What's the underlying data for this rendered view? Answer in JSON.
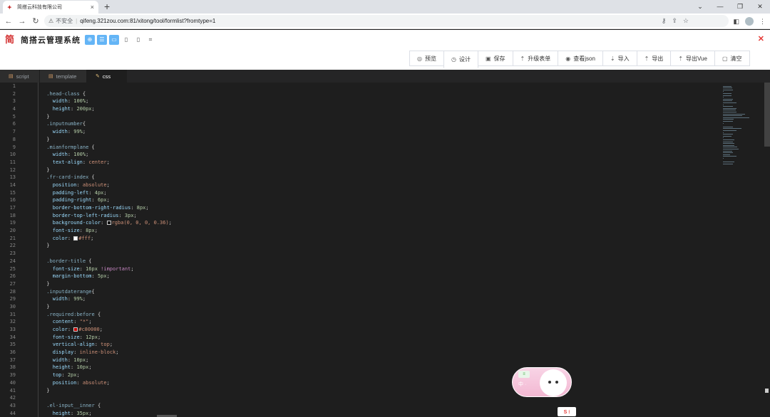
{
  "browser": {
    "tab_title": "简搭云科技有限公司",
    "tab_close": "×",
    "new_tab": "+",
    "url_warning": "⚠",
    "insecure_label": "不安全",
    "url_sep": "|",
    "url": "qifeng.321zou.com:81/xitong/tool/formlist?fromtype=1",
    "win_controls": [
      "⌄",
      "—",
      "❐",
      "✕"
    ]
  },
  "app": {
    "logo_text": "简",
    "title": "简搭云管理系统",
    "header_icons": [
      {
        "name": "globe-icon",
        "glyph": "⊕",
        "active": true
      },
      {
        "name": "menu-icon",
        "glyph": "☰",
        "active": true
      },
      {
        "name": "monitor-icon",
        "glyph": "▭",
        "active": true
      },
      {
        "name": "tablet-icon",
        "glyph": "▯",
        "active": false
      },
      {
        "name": "phone-icon",
        "glyph": "▯",
        "active": false
      },
      {
        "name": "grid-icon",
        "glyph": "⌗",
        "active": false
      }
    ],
    "close_label": "✕"
  },
  "actions": [
    {
      "icon": "◎",
      "label": "预览"
    },
    {
      "icon": "◷",
      "label": "设计",
      "active": true
    },
    {
      "icon": "▣",
      "label": "保存"
    },
    {
      "icon": "⇡",
      "label": "升级表单"
    },
    {
      "icon": "◉",
      "label": "查看json"
    },
    {
      "icon": "⇣",
      "label": "导入"
    },
    {
      "icon": "⇡",
      "label": "导出"
    },
    {
      "icon": "⇡",
      "label": "导出Vue"
    },
    {
      "icon": "▢",
      "label": "清空"
    }
  ],
  "editor_tabs": [
    {
      "icon": "▤",
      "label": "script"
    },
    {
      "icon": "▤",
      "label": "template"
    },
    {
      "icon": "✎",
      "label": "css",
      "active": true
    }
  ],
  "code_lines": [
    [],
    [
      [
        "sel",
        ".head-class"
      ],
      [
        "punc",
        " {"
      ]
    ],
    [
      [
        "prop",
        "  width"
      ],
      [
        "punc",
        ": "
      ],
      [
        "num",
        "100%"
      ],
      [
        "punc",
        ";"
      ]
    ],
    [
      [
        "prop",
        "  height"
      ],
      [
        "punc",
        ": "
      ],
      [
        "num",
        "200px"
      ],
      [
        "punc",
        ";"
      ]
    ],
    [
      [
        "punc",
        "}"
      ]
    ],
    [
      [
        "sel",
        ".inputnumber"
      ],
      [
        "punc",
        "{"
      ]
    ],
    [
      [
        "prop",
        "  width"
      ],
      [
        "punc",
        ": "
      ],
      [
        "num",
        "99%"
      ],
      [
        "punc",
        ";"
      ]
    ],
    [
      [
        "punc",
        "}"
      ]
    ],
    [
      [
        "sel",
        ".mianformplane"
      ],
      [
        "punc",
        " {"
      ]
    ],
    [
      [
        "prop",
        "  width"
      ],
      [
        "punc",
        ": "
      ],
      [
        "num",
        "100%"
      ],
      [
        "punc",
        ";"
      ]
    ],
    [
      [
        "prop",
        "  text-align"
      ],
      [
        "punc",
        ": "
      ],
      [
        "val",
        "center"
      ],
      [
        "punc",
        ";"
      ]
    ],
    [
      [
        "punc",
        "}"
      ]
    ],
    [
      [
        "sel",
        ".fr-card-index"
      ],
      [
        "punc",
        " {"
      ]
    ],
    [
      [
        "prop",
        "  position"
      ],
      [
        "punc",
        ": "
      ],
      [
        "val",
        "absolute"
      ],
      [
        "punc",
        ";"
      ]
    ],
    [
      [
        "prop",
        "  padding-left"
      ],
      [
        "punc",
        ": "
      ],
      [
        "num",
        "4px"
      ],
      [
        "punc",
        ";"
      ]
    ],
    [
      [
        "prop",
        "  padding-right"
      ],
      [
        "punc",
        ": "
      ],
      [
        "num",
        "6px"
      ],
      [
        "punc",
        ";"
      ]
    ],
    [
      [
        "prop",
        "  border-bottom-right-radius"
      ],
      [
        "punc",
        ": "
      ],
      [
        "num",
        "8px"
      ],
      [
        "punc",
        ";"
      ]
    ],
    [
      [
        "prop",
        "  border-top-left-radius"
      ],
      [
        "punc",
        ": "
      ],
      [
        "num",
        "3px"
      ],
      [
        "punc",
        ";"
      ]
    ],
    [
      [
        "prop",
        "  background-color"
      ],
      [
        "punc",
        ": "
      ],
      [
        "sw",
        "rgba(0,0,0,0.36)"
      ],
      [
        "val",
        "rgba(0, 0, 0, 0.36)"
      ],
      [
        "punc",
        ";"
      ]
    ],
    [
      [
        "prop",
        "  font-size"
      ],
      [
        "punc",
        ": "
      ],
      [
        "num",
        "8px"
      ],
      [
        "punc",
        ";"
      ]
    ],
    [
      [
        "prop",
        "  color"
      ],
      [
        "punc",
        ": "
      ],
      [
        "sw",
        "#ffffff"
      ],
      [
        "val",
        "#fff"
      ],
      [
        "punc",
        ";"
      ]
    ],
    [
      [
        "punc",
        "}"
      ]
    ],
    [],
    [
      [
        "sel",
        ".border-title"
      ],
      [
        "punc",
        " {"
      ]
    ],
    [
      [
        "prop",
        "  font-size"
      ],
      [
        "punc",
        ": "
      ],
      [
        "num",
        "16px"
      ],
      [
        "imp",
        " !important"
      ],
      [
        "punc",
        ";"
      ]
    ],
    [
      [
        "prop",
        "  margin-bottom"
      ],
      [
        "punc",
        ": "
      ],
      [
        "num",
        "5px"
      ],
      [
        "punc",
        ";"
      ]
    ],
    [
      [
        "punc",
        "}"
      ]
    ],
    [
      [
        "sel",
        ".inputdaterange"
      ],
      [
        "punc",
        "{"
      ]
    ],
    [
      [
        "prop",
        "  width"
      ],
      [
        "punc",
        ": "
      ],
      [
        "num",
        "99%"
      ],
      [
        "punc",
        ";"
      ]
    ],
    [
      [
        "punc",
        "}"
      ]
    ],
    [
      [
        "sel",
        ".required:before"
      ],
      [
        "punc",
        " {"
      ]
    ],
    [
      [
        "prop",
        "  content"
      ],
      [
        "punc",
        ": "
      ],
      [
        "val",
        "\"*\""
      ],
      [
        "punc",
        ";"
      ]
    ],
    [
      [
        "prop",
        "  color"
      ],
      [
        "punc",
        ": "
      ],
      [
        "sw",
        "#c80000"
      ],
      [
        "val",
        "#c80000"
      ],
      [
        "punc",
        ";"
      ]
    ],
    [
      [
        "prop",
        "  font-size"
      ],
      [
        "punc",
        ": "
      ],
      [
        "num",
        "12px"
      ],
      [
        "punc",
        ";"
      ]
    ],
    [
      [
        "prop",
        "  vertical-align"
      ],
      [
        "punc",
        ": "
      ],
      [
        "val",
        "top"
      ],
      [
        "punc",
        ";"
      ]
    ],
    [
      [
        "prop",
        "  display"
      ],
      [
        "punc",
        ": "
      ],
      [
        "val",
        "inline-block"
      ],
      [
        "punc",
        ";"
      ]
    ],
    [
      [
        "prop",
        "  width"
      ],
      [
        "punc",
        ": "
      ],
      [
        "num",
        "10px"
      ],
      [
        "punc",
        ";"
      ]
    ],
    [
      [
        "prop",
        "  height"
      ],
      [
        "punc",
        ": "
      ],
      [
        "num",
        "10px"
      ],
      [
        "punc",
        ";"
      ]
    ],
    [
      [
        "prop",
        "  top"
      ],
      [
        "punc",
        ": "
      ],
      [
        "num",
        "2px"
      ],
      [
        "punc",
        ";"
      ]
    ],
    [
      [
        "prop",
        "  position"
      ],
      [
        "punc",
        ": "
      ],
      [
        "val",
        "absolute"
      ],
      [
        "punc",
        ";"
      ]
    ],
    [
      [
        "punc",
        "}"
      ]
    ],
    [],
    [
      [
        "sel",
        ".el-input__inner"
      ],
      [
        "punc",
        " {"
      ]
    ],
    [
      [
        "prop",
        "  height"
      ],
      [
        "punc",
        ": "
      ],
      [
        "num",
        "35px"
      ],
      [
        "punc",
        ";"
      ]
    ]
  ],
  "widget": {
    "tag": "≡",
    "text": "中 ·",
    "ime_label": "S ⁝"
  }
}
